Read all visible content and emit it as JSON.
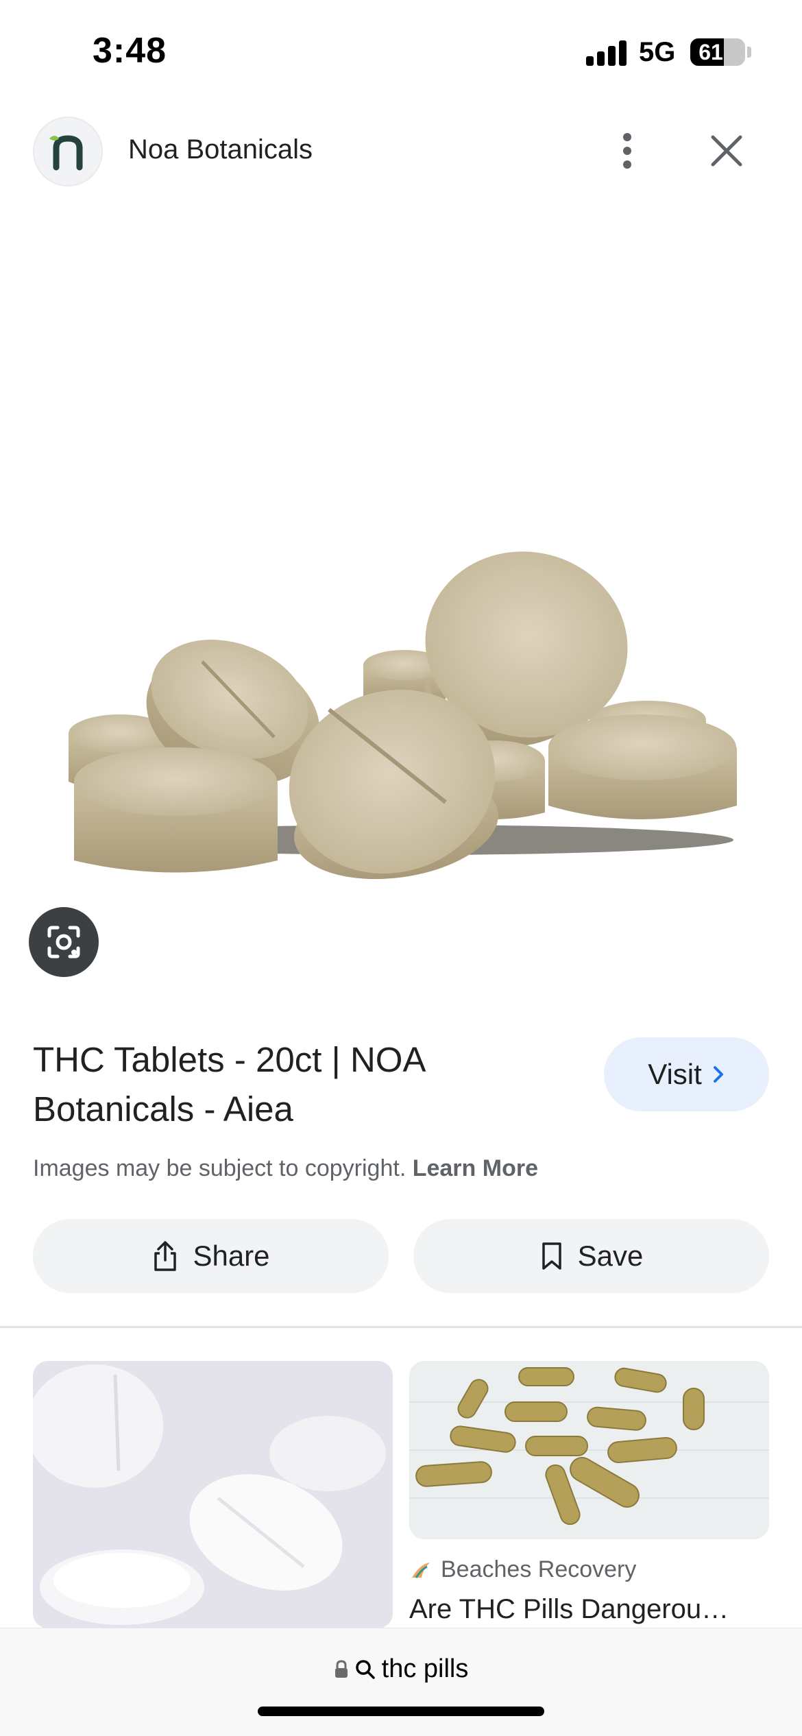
{
  "status_bar": {
    "time": "3:48",
    "network": "5G",
    "battery": "61",
    "battery_level": 0.61
  },
  "site": {
    "name": "Noa Botanicals",
    "logo_icon": "noa-botanicals-logo"
  },
  "result": {
    "title": "THC Tablets - 20ct | NOA Botanicals - Aiea",
    "visit_label": "Visit",
    "copyright_text": "Images may be subject to copyright.",
    "learn_more": "Learn More",
    "share_label": "Share",
    "save_label": "Save"
  },
  "related": [
    {
      "source": "",
      "title": ""
    },
    {
      "source": "Beaches Recovery",
      "title": "Are THC Pills Dangerou…"
    }
  ],
  "url_bar": {
    "query": "thc pills"
  },
  "colors": {
    "visit_bg": "#e8f0fe",
    "accent_blue": "#1a73e8",
    "button_bg": "#f1f3f4",
    "logo_green": "#8bc34a",
    "logo_dark": "#24433a"
  }
}
